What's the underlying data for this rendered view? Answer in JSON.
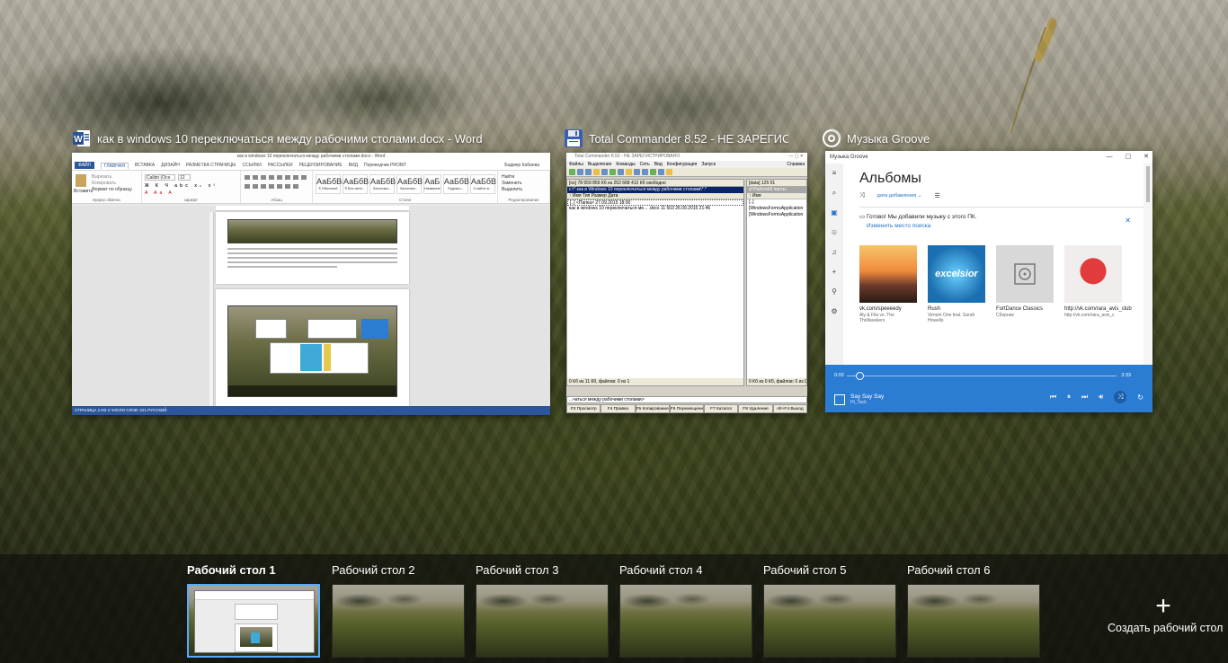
{
  "colors": {
    "accent": "#5aa9ff",
    "word_blue": "#2b579a",
    "groove_blue": "#2b7cd3"
  },
  "windows": {
    "word": {
      "title": "как в windows 10 переключаться между рабочими столами.docx - Word",
      "icon": "word-icon",
      "inner_title": "как в windows 10 переключаться между рабочими столами.docx - Word",
      "tabs": [
        "ФАЙЛ",
        "ГЛАВНАЯ",
        "ВСТАВКА",
        "ДИЗАЙН",
        "РАЗМЕТКА СТРАНИЦЫ",
        "ССЫЛКИ",
        "РАССЫЛКИ",
        "РЕЦЕНЗИРОВАНИЕ",
        "ВИД",
        "Переводчик PROMT"
      ],
      "user": "Бадмер Кабаева",
      "ribbon": {
        "paste": "Вставить",
        "cut": "Вырезать",
        "copy": "Копировать",
        "format_painter": "Формат по образцу",
        "font_name": "Calibri (Осн",
        "font_size": "12",
        "find": "Найти",
        "replace": "Заменить",
        "select": "Выделить",
        "groups": [
          "Буфер обмена",
          "Шрифт",
          "Абзац",
          "Стили",
          "Редактирование"
        ],
        "styles": [
          {
            "sample": "АаБбВв",
            "name": "¶ Обычный"
          },
          {
            "sample": "АаБбВ",
            "name": "¶ Без инте..."
          },
          {
            "sample": "АаБбВ",
            "name": "Заголово..."
          },
          {
            "sample": "АаБбВ",
            "name": "Заголово..."
          },
          {
            "sample": "АаБ",
            "name": "Название"
          },
          {
            "sample": "АаБбВ",
            "name": "Подзаго..."
          },
          {
            "sample": "АаБбВ",
            "name": "Слабое в..."
          }
        ]
      },
      "status": "СТРАНИЦА 2 ИЗ 2   ЧИСЛО СЛОВ: 221   РУССКИЙ"
    },
    "total_commander": {
      "title": "Total Commander 8.52 - НЕ ЗАРЕГИСТ...",
      "icon": "floppy-disk-icon",
      "inner_title": "Total Commander 8.52 - НЕ ЗАРЕГИСТРИРОВАНО",
      "menu": [
        "Файлы",
        "Выделение",
        "Команды",
        "Сеть",
        "Вид",
        "Конфигурация",
        "Запуск"
      ],
      "menu_help": "Справка",
      "left_drive": "[os]  78 659 856 Кб из 252 668 412 Кб свободно",
      "left_path": "c:\\*.как в Windows 10 переключаться между рабочими столами\\*.*",
      "left_head": "↑ Имя                              Тип  Размер   Дата",
      "left_rows": [
        "[..]                                          <Папка> 27.09.2015 18:00",
        "как в windows 10 переключаться ме...  .docx   11 503 26.09.2015 21:46"
      ],
      "left_foot": "0 Кб из 11 Кб, файлов: 0 из 1",
      "right_drive": "[data]  125 01",
      "right_path": "d:\\Работа\\6 часть\\",
      "right_head": "↑ Имя",
      "right_rows": [
        "[..]",
        "[WindowsFormsApplication",
        "[WindowsFormsApplication"
      ],
      "right_foot": "0 Кб из 0 Кб, файлов: 0 из 0",
      "cmdline": "...чаться между рабочими столами>",
      "fkeys": [
        "F3 Просмотр",
        "F4 Правка",
        "F5 Копирование",
        "F6 Перемещение",
        "F7 Каталог",
        "F8 Удаление",
        "Alt+F4 Выход"
      ]
    },
    "groove": {
      "title": "Музыка Groove",
      "icon": "groove-music-icon",
      "inner_title": "Музыка Groove",
      "heading": "Альбомы",
      "sort": "дата добавления ⌄",
      "notice": "Готово! Мы добавили музыку с этого ПК.",
      "notice_link": "Изменить место поиска",
      "albums": [
        {
          "name": "vk.com/speeeedy",
          "artist": "Aly & Fila vs. The Thrillseekers",
          "art": "sunset-island"
        },
        {
          "name": "Rush",
          "artist": "Venom One feat. Sarah Howells",
          "art": "excelsior"
        },
        {
          "name": "FortDance Classics",
          "artist": "Сборник",
          "art": "placeholder-disc"
        },
        {
          "name": "http://vk.com/rara_avis_club",
          "artist": "http://vk.com/rara_avis_c",
          "art": "red-cover"
        }
      ],
      "player": {
        "time_elapsed": "0:03",
        "time_total": "3:33",
        "progress": 0.014,
        "track": "Say Say Say",
        "artist": "Hi_Tack"
      }
    }
  },
  "desktops": [
    {
      "label": "Рабочий стол 1",
      "active": true
    },
    {
      "label": "Рабочий стол 2",
      "active": false
    },
    {
      "label": "Рабочий стол 3",
      "active": false
    },
    {
      "label": "Рабочий стол 4",
      "active": false
    },
    {
      "label": "Рабочий стол 5",
      "active": false
    },
    {
      "label": "Рабочий стол 6",
      "active": false
    }
  ],
  "new_desktop": {
    "icon": "plus-icon",
    "label": "Создать рабочий стол"
  }
}
